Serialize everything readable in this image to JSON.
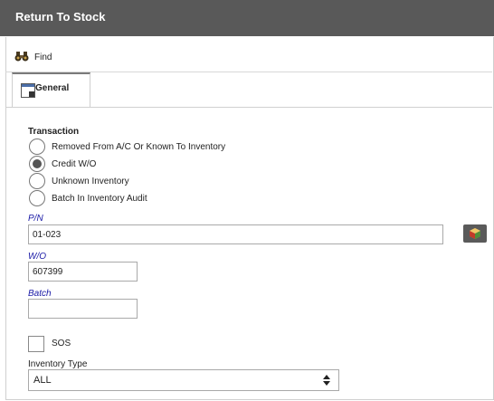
{
  "window": {
    "title": "Return To Stock"
  },
  "toolbar": {
    "find_label": "Find",
    "find_icon": "binoculars-icon"
  },
  "tabs": [
    {
      "label": "General",
      "icon": "window-icon",
      "active": true
    }
  ],
  "transaction": {
    "heading": "Transaction",
    "options": [
      {
        "label": "Removed From A/C Or Known To Inventory",
        "selected": false
      },
      {
        "label": "Credit W/O",
        "selected": true
      },
      {
        "label": "Unknown Inventory",
        "selected": false
      },
      {
        "label": "Batch In Inventory Audit",
        "selected": false
      }
    ]
  },
  "fields": {
    "pn": {
      "label": "P/N",
      "value": "01-023"
    },
    "wo": {
      "label": "W/O",
      "value": "607399"
    },
    "batch": {
      "label": "Batch",
      "value": ""
    }
  },
  "sos": {
    "label": "SOS",
    "checked": false
  },
  "inventory_type": {
    "label": "Inventory Type",
    "value": "ALL"
  },
  "colors": {
    "titlebar": "#595959",
    "required_label": "#1a1aa6"
  }
}
